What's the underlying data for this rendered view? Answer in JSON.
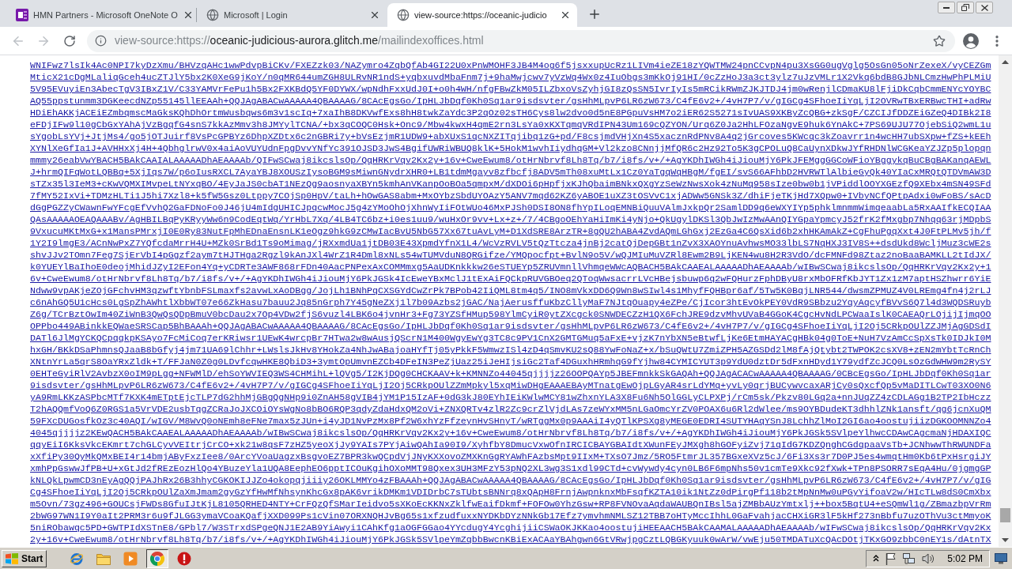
{
  "browser": {
    "tabs": [
      {
        "title": "HMN Partners - Microsoft OneNote O",
        "selected": false
      },
      {
        "title": "Microsoft | Login",
        "selected": false
      },
      {
        "title": "view-source:https://oceanic-judicio",
        "selected": true
      }
    ],
    "nav": {
      "back_enabled": false,
      "forward_enabled": false
    },
    "address_bar": {
      "url_prefix": "view-source:https://",
      "url_host": "oceanic-judicious-aurora.glitch.me",
      "url_path": "/mailindexoffices.html"
    }
  },
  "source_lines": [
    "WNIFwz7lsIk4Ac0NPI7kyDzXmu/BHVzqAHc1wwPdvpBiCKv/FXEZzk03/NAZymro4ZqbQfAb4GI22U0xPnWMOHF3JB4M4og6f5jsxxupUcRz1LIVm4ieZE18zYQWTMW24pnCCvpN4pu3XsGG0ugVglg5OsGn05oNrZexeX/vyCEZGm",
    "MticX21cDgMLaliqGceh4ucZTJlY5bx2K0XeG9jKoY/n0qMR644umZGH8ULRvNR1ndS+yqbxuvdMbaFnm7j+9haMwjcwv7yVzWq4Wx0z4IuObgs3mKkOj91HI/0cZzHoJ3a3ct3ylz7uJzVMLr1X2Vkq6bdB8GJbNLCmzHwPhPLMiU",
    "5V95EVuyiEn3AbecTgV3IBxZ1V/C33YAMVrFePu1h5Bx2FXKBdQ5YF0DYWX/wpNdhFxxUdJ0I+o0h4WH/nfgFBwZkM05ILZbxoVsZyhjGI8zQsSN5IvrIyIs5mRCikRWmZJKJTDJ4jm0wRenjlCDmaKU8lFjiDkCqbCmmENYcYOYBC",
    "AQ55ppstunmm3DGKeecdNZp55145llEEAAh+QQJAgABACwAAAAA4QBAAAAG/8CAcEgsGo/IpHLJbDqf0Kh0Sq1ar9isdsvter/gsHhMLpvP6LR6zW673/C4fE6v2+/4vH7P7/v/gIGCg4SFhoeIiYqLjI2OVRwTBxERBwcTHI+adRw",
    "HDiEhAKKjACEiEZmbqmscMaGksKQhDhOrtmWusbqws6m3v1scIq+7xaIhB8DKVwfExs8hH8twkZaYdc3P2qOz02sTH6Cys8lw2dvo0d5nE8PGpuVsHM7o2iER62S5271sIvUAS9XKByZcQBG+zkSgF/CZCIJfDDZEiGZeQ4DIBk2I8",
    "eFDjIFw9l10gCbGxYAhAjVzBgqfG4snS7kkAzMmv3h8JMYylTCNA/+bx3qCOQC0Hsk+Onc9/Mbw4kwxH4qmE2rn3LsYa0xKXTqmqVRdIPN43Um169cQZYON/Urq6Z0Ja2HhLFOzaNgvE9huk6YnAkC+7PS69UJU77OjebSiQ2wmL1u",
    "sYgobLsYVj+JtjMs4/go5jOTJuirf8VsPcGPBYz6DhpXZDtx6c2nGBRi7y+bVsEzjmR1UDW9+abXUxS1qcNXZITqjibq1zG+pd/F8csjmdVHjXn4S5xacznRdPNv8A4q2jGrcoves5KWcqc3kZoavrr1n4wcHH7ubSXpw+fZS+kEEh",
    "XYNlXeGfIa1J+AVHHxXj4H+4QbhglrwV0x4aiAoVUYUdnFpgDvvYNfYc391OJSD3JwS4BgifUWRiWBUQ8klK+5HokM1wvhIiydhqGM+Vl2kzo8CNnjjMfQR6c2Hz92To5K3gCPOLuQ8CaUynXDkwJYfRHDNlWCGKeaYZJZp5plopqn",
    "mmmy26eabVwYBACH5BAkCAAIALAAAAADhAEAAAAb/QIFwSCwaj8ikcslsOp/QqHRKrVqv2Kx2y+16v+CweEwum8/otHrNbrvf8Lh8Tq/b7/i8fs/v+/+AgYKDhIWGh4iJiouMjY6PkJFEMggGGCoWFioYBggykqBuCBgBAKanqAEWL",
    "J+hrmQIFqWotLQBBq+5XjIqs7W/p6oIusRXCL7AyaYBJ8XOUSzIysoBGM9sMiwnGNydrXHR0+LB1tdmMgayv8zfbcfj8ADV5mTh08xuMtLx1Cz0YaTgqWqHBgM/fgEI/svS66AFhbD2HVRWTlAlbieGyQk40YIaCxMRQtQTDVmAW3D",
    "sTZx35l3IeM3+cKwVQMXIMvpeLtNYxqBO/4EyJaJS0cbAT1NEzQg9aosnyaXBYn5kmhAnVKanpOoBOa5qmpxM/dXDOi6pHpfjxKJhQbaimBNkxQXgYzSeWzNwsXok4zNuMq958sIze0bw0b1jVPiddlOOYXGEzfQ9XEbx4mSN49SFd",
    "7fMY52IxVi+TDMzHLTi1J5hi7Xzl8+k5fW5Gsz0Ltppy7COjSp0HpV/taLh+hOwGAS8abm+MxOYbzSbdUYOAzY5ANV7mqd62KZ6yABOE1uXZ3tOSVvC1xjADWw5GNSk3Z/dhiFjeTKjHd7XQpw0+IVbyNCfQPtpAdxi0wFoBS/sAcD",
    "dGgPGZZyCWawnFwYFcgEfVvhQ2GaFDNoFo0J46jU4mIdgUHICJpqcwMocJ5g4zYMoOhOjXhnWyIiFOtWUo46MxPJSh0DSI8ON8fhYpILoqEMNBiQuuVAlmJxkpQr2SamlDD9q6eWXYIYp5phklmnmmWimqeaabLa5RxAAIfkECQIAA",
    "QAsAAAAAOEAQAAABv/AgHBILBqPyKRyyWw6n9CodEqtWq/YrHbL7Xq/4LB4TC6bz+i0es1uu9/wuHxOr9vv+Lx+z+/7/4CBgoOEhYaHiImKi4yNjo+QkUgylDKSl3QbJwIzMwAAnQIYGpaYpmcyJ52frK2fMxgbp7Nhqq63rjMDpbS",
    "9VxucuMKtMxG+x1MansPMrxjI0E0Ry83NutFpMhEDnaEnsnLK1eOgz9hkG9zCMwIacBvU5NbG57Xx67tuAvLyM+D1XdSRE8ArzTR+8gQU2hABA4ZvdAQmLGhGxj2EzGa4C6QsXid6b2xhHKAmAkZ+CgFhuPgqXxt4J0FtPLMv5jh/f",
    "1Y2I9lmgE3/ACnNwPxZ7YQfcdaMrrH4U+MZk0SrBd1Ts9oMimag/jRXxmdUa1jtDB03E43XpmdYfnX1L4/WcVzRVLV5tQzTtcza4jnBj2catQjDepGBt1nZvX3XAOYnuAvhwsMO33lbLS7NqHXJ3IV8S++dsdUkd8WcljMuz3cWE2s",
    "shvJJv2TOmn7Feg7SjErVbI4pGgzf2aym7tHJTHga2Rgzl9kAnJXl4WrZ1R4Dml8xNLs54wTUMVduN8QRGifze/YMQpocfpt+BvlN9o5V/wQJMIuMuVZRl8Ewm2B9LjKEN4wu8H2R3VdO/dcFMNFd98Ztaz2noBaaBAMKLL2tIdJX/",
    "k0YUEYlBaIhoE0deojMhidJZyI2EFon4Yq+yCDRTe3AWF868rFDn40AacPNPexAxCOMMmxg5AaUDKnkkkw26eSTUEYp5ZRUVmnllVhmqeWWcAQBACH5BAkCAAEALAAAAADhAEAAAAb/wIBwSCwaj8ikcslsOp/QqHRKrVqv2Kx2y+1",
    "6v+CweEwum8/otHrNbrvf8Lh8Tq/b7/i8fs/v+/+AgYKDhIWGh4iJiouMjY6PkJGSk4IcEweYBxMclJ1tExAiFQCkpRUVGBOeq2QToqWwsacrrLVcHBejsbuwp6q2wFQHurzFphDByU8rxMbOFRfKbJYT1Zx1zM7aptHSZhwrr6YiE",
    "Ndww9vpAKjeZOjGFchvHM3qzwftYbnbFSLmaxfs2avwLxAoDBgg/JojLh1BNhPqCXSGYdCwZrPk7BPob42IiQML8tm4q5/INO8mVkxDD6Q9Wn8wSIwl4s1MhyfFQHBpr6af/5Tw5K0BqjLNR544/dwsmZPMUZ4V0LREmg4fn4j2rLJ",
    "c6nAhGQ5U1cHcs0LgSpZhAWhtlXbbWT07e66ZkHasu7bauu2Jq85nGrph7Y45gNeZXj1l7b09Azbs2jGAC/NajAerusffuKbzCllyMaF7NJtqOuapy4eZPe/CjIcor3htEvOkPEY0VdR9SBbzu2YqyAqcyfBVvS6Q7l4d3WQDSRuyb",
    "Z6g/TCrBztOwIm40ZiWnB3QwQsQDpBmuV0bcDau2x7Op4VDw2fjS6vuzl4LBK6o4jvnHr3+Fg73YZSfHMup598YlmCyiR0ytZXcgck0SNWDECZzH1QX6FchJRE9dzvMhvUVaB4GGoK4CgcHvNdLPCWaaIslK0CAEAQrLOjijIjmqOO",
    "OPPbo449ABinkkEQWaeSRSCap5BhBAAAh+QQJAgABACwAAAAA4QBAAAAG/8CAcEgsGo/IpHLJbDqf0Kh0Sq1ar9isdsvter/gsHhMLpvP6LR6zW673/C4fE6v2+/4vH7P7/v/gIGCg4SFhoeIiYqLjI2Oj5CRkpOUlZZJMjAgGDSdI",
    "DATl6JlMgYCKQCpqqkpKSAyo7FcMiCoq7erKRiwsr1UEwK4wrcpBr7HTwa2w8wAusjQScrN1M400WgyEwYg3TC8c9PV1CnX2GMTGMuq5aFxE+vjzK7nYbXN5eBtwfLjKe6EtmHAYACgHBk04g0ToE+NuH7VzAmCcSpXsTk0IDJkI0M",
    "hxGH/BKkDSaPhmnsQJaaB8bGfyj4jm71UA69lChhr+LWslsJkHv8YHokZa4NhJwABajoaHYfTj05yPkkF5WmwzISl4zD4qSmvKU2sQ88YwFoNaZ+x/bSuQWtU7ZmiZPH5AZGSDd2lM8fAjQtybt2TWPOK2csXV8+zEN2mYbtTcRnCh",
    "XNtnYrLa5qrS8OaYRxZldk+T/FFJaN0Z0g0LDvfcqwHKE8QbiD3+3ymtOpUmvnEZCb4DFeIN3PeZjUaz25iJeHIjsiGc2Taf4DGuxhHRmhqG9fYjhw84CYMICYUT3p9YdU0dztDr5dFxnHDyd1Y79ydfZcJCQ0LsOzGdWHW9m2RySY",
    "0EHTeGyiRlV2AvbzX0oIM9pLgg+NFWMlD/ehSoYWVIEQ3WS4CHMihL+lQVg5/I2KjDQg0CHCKAAV+k+KMNNZo44045qjjjjz26OOPQAYp5JBEFmnkkSkGAQAh+QQJAgACACwAAAAA4QBAAAAG/0CBcEgsGo/IpHLJbDqf0Kh0Sq1ar",
    "9isdsvter/gsHhMLpvP6LR6zW673/C4fE6v2+/4vH7P7/v/gIGCg4SFhoeIiYqLjI2Oj5CRkpOUlZZmMpkyl5xqMiwDHgEAAAEBAyMTnatgEwOjpLGyAR4srLdYMq+yvLy0qrjBUCywvcaxARjCy0sQxcfQp5vMaDITLCwT03XO0N6",
    "yA9RmLKKzASPbcMTf7KXK4mETptEjcTLP7dG2hhMjGBgQgNHp9i0ZnAH58gVIB4jYM1P15IzAF+0dG3kJ80EYhIEiKWlwMCY81wZhxnYLA3X8Fu6Nh5OlGGLyCLPXPj/rCm5sk/Pkzv80LGq2a+nnJUqZZ4zCDLAGg1B2TP2IbHczz",
    "T2hAQQmfVoQ6Z0RGS1a5VrVDE2usbTqgZCRaJoJXCOiOYsWgNo8bBO6RQP3qdyZdaHdxQM2oVi+ZNXQRTv4zlR2Zc9crZlVjdLAs7zeWYxMM5nLGaOmcYrZV0POAX6u6Rl2dWlee/ms9OYBDudeKT3dhhlZNk1ansft/qg6jcnXuQM",
    "59FXcDUGosfkOz3c40AQI/wIGV/M8WvQ0oNEmh8eFNe7max5zJUn+i4yJD1NvPzMx8Pf2W6xhYzFfzeynHvSHnyT/wRTggMx0p9AAAiI4yQTlKPSXg8yMEGE0EDRI4SUTYHAqYSnJ8LchhZlMoI2GI6ao4oostujiizDGKOOMNNZo4",
    "4045qjjjjz2KEwQACH5BAkCAAEALAAAAADhAEAAAAb/wIBwSCwaj8ikcslsOp/QqHRKrVqv2Kx2y+16v+CweEwum8/otHrNbrvf8Lh8Tq/b7/i8fs/v+/+AgYKDhIWGh4iJiouMjY6PkJGSk5SVlpeYlhwcCDAwCAgcmaNjHDAXIQC",
    "qqyEiI6KksVkcEKmrt7chGLCyvVEItrjCrCO+xk21w8qsF7zHZ5yeoXjJy9YAIs7PYjAiwQAhIa90I9/XyhfbY8DmucVxwOfnIRCICBAYGBAIdtXWunFEyJMXgh8hGOFyiZvj71qIdG7KDZQnghCGdqpaaVsTb+JCNhwwThRWUNDFa",
    "xXfiPy30QyMkQMxBEI4r14bmjAByFxzIee8/0ArcYVoaUagzxBsgvoEZ7BPR3kwQCpdVjJNyKXXovoZMXKnGgRYAWhFAzbsMpt9IIxM+TXsO7Jmz/5RO5FtmrJL357BGxeXVz5cJ/6Fi3Xs3r7D0PJ5es4wmqtHm0Kb6tPxHsrgiJY",
    "xmhPpGswwJfPB+U+xGtJd2fREzEozHlQo4YBuzeYla1UQA8EephEO6pptICOuKgihOXoMMT98Qxex3UH3MFzY53pNQ2XL3wg3S1xdl99CTd+cvWywdy4cyn0LB6F6mpNhs50v1cmTe9Xkc92fXwk+TPn8PSORR7sEqA4Hu/0jgmgGP",
    "kNLQkLpwmCD3nEyAgQQjPAJhRx26B3hhyCGKOKIJJZo4okopqjiiiy26OKLMMYo4zFBAAAh+QQJAgABACwAAAAA4QBAAAAG/8CAcEgsGo/IpHLJbDqf0Kh0Sq1ar9isdsvter/gsHhMLpvP6LR6zW673/C4fE6v2+/4vH7P7/v/gIG",
    "Cg4SFhoeIiYqLjI2Oj5CRkpOUlZaXmJmam2gyGzYfHwMfNhsynKhcGx8pAK6vrikDMKm1VDIDrbC7sTUbtsBNNrq8xQApH8FrnjAwpnknxMbFsqfKZTA10ik1NtZz0dPirgPf118b2tMpNnMw0uPGyYifoaV2w/HIcTLw8dS0CmXbx",
    "m5Ovn/73gz496+GOUCsjFWDs8GfuIJtKjL8105QRHED4NTY+CrFQzQfSMarIeidvo5sXKoEcKKNxZklfwEaifDkmf+FOFOw0YhzGsw+RP8FVNOvaAqdaWAUBQnIBsl5ajZMBbAUzYmtxlj++box5BqtU4+eSQmWl1g/ZBmazbpVrRm",
    "2bWG97WN1I9Y0aIt2PRM3r6u9fJLGG3ymaVCoaKQafjXXD099Ps1cVin07ORXNQHJvBg65s1xfzudfuxxNYDKbDYzNNkGb17Efz7ymvhmNMLSZ12TBB7oHTyMccIhhL0GaFvahjacCHXiGR3lF5kHf273nBbfu7uzOThVu3ctMmyoK",
    "5niRObawqc5PD+GWTPIdXSTnE8/GPbl7/W3STrxdSPgeQNJ1E2AB9YiAwyi1CAhKfg1aOGFGGao4YYcdugY4YcghijiiCSWaOKJKKao4oostujiHEEAACH5BAkCAAMALAAAAADhAEAAAAb/wIFwSCwaj8ikcslsOp/QqHRKrVqv2Kx",
    "2y+16v+CweEwum8/otHrNbrvf8Lh8Tq/b7/i8fs/v+/+AgYKDhIWGh4iJiouMjY6PkJGSk5SVlpeYmZqbbBwcnKBiExACAaYBAhgwn6GtVRwjpgCztLQBGKyuuk0wArW/vwEju50TMDATuXcQAcDOtjTKxGO9zbbC0nEY1s/dAtnTX"
  ],
  "taskbar": {
    "start_label": "Start",
    "apps": [
      {
        "selected": false
      },
      {
        "selected": false
      },
      {
        "selected": false
      },
      {
        "selected": true
      },
      {
        "selected": false
      }
    ],
    "clock": "5:02 PM"
  }
}
